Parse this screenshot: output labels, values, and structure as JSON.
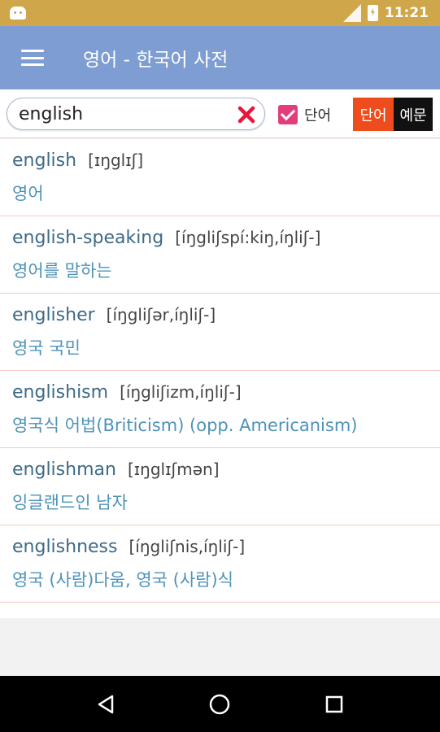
{
  "status_bar": {
    "time": "11:21",
    "icons": [
      "android-icon",
      "signal-icon",
      "battery-icon"
    ]
  },
  "app_bar": {
    "title": "영어 - 한국어 사전",
    "menu_icon": "menu-icon"
  },
  "search": {
    "value": "english",
    "placeholder": "",
    "clear_icon": "clear-icon",
    "checkbox_label": "단어",
    "checkbox_checked": true,
    "toggle_word": "단어",
    "toggle_example": "예문"
  },
  "results": [
    {
      "word": "english",
      "phonetic": "[ɪŋglɪʃ]",
      "meaning": "영어"
    },
    {
      "word": "english-speaking",
      "phonetic": "[íŋgliʃspí:kiŋ,íŋliʃ-]",
      "meaning": "영어를 말하는"
    },
    {
      "word": "englisher",
      "phonetic": "[íŋgliʃər,íŋliʃ-]",
      "meaning": "영국 국민"
    },
    {
      "word": "englishism",
      "phonetic": "[íŋgliʃizm,íŋliʃ-]",
      "meaning": "영국식 어법(Briticism) (opp. Americanism)"
    },
    {
      "word": "englishman",
      "phonetic": "[ɪŋglɪʃmən]",
      "meaning": "잉글랜드인 남자"
    },
    {
      "word": "englishness",
      "phonetic": "[íŋgliʃnis,íŋliʃ-]",
      "meaning": "영국 (사람)다움, 영국 (사람)식"
    }
  ],
  "nav_bar": {
    "icons": [
      "back-icon",
      "home-icon",
      "recents-icon"
    ]
  },
  "colors": {
    "status_bar": "#cfa649",
    "app_bar": "#7e9dd2",
    "word": "#3d6a88",
    "meaning": "#4e93b8",
    "toggle_active": "#ee4c1c",
    "checkbox": "#e43d7b",
    "clear": "#e6173a"
  }
}
